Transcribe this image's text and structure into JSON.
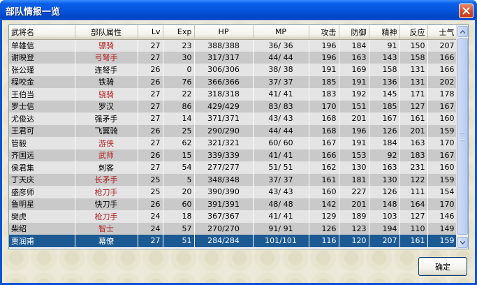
{
  "window": {
    "title": "部队情报一览",
    "ok_label": "确定"
  },
  "columns": [
    "武将名",
    "部队属性",
    "Lv",
    "Exp",
    "HP",
    "MP",
    "攻击",
    "防御",
    "精神",
    "反应",
    "士气"
  ],
  "rows": [
    {
      "name": "单雄信",
      "attr": "骠骑",
      "attr_red": true,
      "lv": "27",
      "exp": "23",
      "hp": "388/388",
      "mp": "36/ 36",
      "atk": "196",
      "def": "184",
      "spi": "91",
      "rea": "150",
      "mor": "207"
    },
    {
      "name": "谢映登",
      "attr": "弓弩手",
      "attr_red": true,
      "lv": "27",
      "exp": "30",
      "hp": "317/317",
      "mp": "44/ 44",
      "atk": "196",
      "def": "163",
      "spi": "143",
      "rea": "158",
      "mor": "166"
    },
    {
      "name": "张公瑾",
      "attr": "连弩手",
      "attr_red": false,
      "lv": "26",
      "exp": "0",
      "hp": "306/306",
      "mp": "38/ 38",
      "atk": "191",
      "def": "169",
      "spi": "158",
      "rea": "131",
      "mor": "166"
    },
    {
      "name": "程咬金",
      "attr": "铁骑",
      "attr_red": false,
      "lv": "26",
      "exp": "76",
      "hp": "366/366",
      "mp": "37/ 37",
      "atk": "185",
      "def": "191",
      "spi": "136",
      "rea": "131",
      "mor": "202"
    },
    {
      "name": "王伯当",
      "attr": "骁骑",
      "attr_red": true,
      "lv": "27",
      "exp": "22",
      "hp": "318/318",
      "mp": "41/ 41",
      "atk": "183",
      "def": "192",
      "spi": "145",
      "rea": "171",
      "mor": "178"
    },
    {
      "name": "罗士信",
      "attr": "罗汉",
      "attr_red": false,
      "lv": "27",
      "exp": "86",
      "hp": "429/429",
      "mp": "83/ 83",
      "atk": "170",
      "def": "151",
      "spi": "185",
      "rea": "127",
      "mor": "167"
    },
    {
      "name": "尤俊达",
      "attr": "强矛手",
      "attr_red": false,
      "lv": "27",
      "exp": "14",
      "hp": "371/371",
      "mp": "43/ 43",
      "atk": "168",
      "def": "201",
      "spi": "167",
      "rea": "161",
      "mor": "160"
    },
    {
      "name": "王君可",
      "attr": "飞翼骑",
      "attr_red": false,
      "lv": "26",
      "exp": "25",
      "hp": "290/290",
      "mp": "44/ 44",
      "atk": "168",
      "def": "196",
      "spi": "126",
      "rea": "201",
      "mor": "159"
    },
    {
      "name": "管毅",
      "attr": "游侠",
      "attr_red": true,
      "lv": "27",
      "exp": "62",
      "hp": "321/321",
      "mp": "60/ 60",
      "atk": "167",
      "def": "191",
      "spi": "184",
      "rea": "163",
      "mor": "170"
    },
    {
      "name": "齐国远",
      "attr": "武师",
      "attr_red": true,
      "lv": "26",
      "exp": "15",
      "hp": "339/339",
      "mp": "41/ 41",
      "atk": "166",
      "def": "153",
      "spi": "92",
      "rea": "183",
      "mor": "167"
    },
    {
      "name": "侯君集",
      "attr": "刺客",
      "attr_red": false,
      "lv": "27",
      "exp": "54",
      "hp": "277/277",
      "mp": "51/ 51",
      "atk": "162",
      "def": "130",
      "spi": "163",
      "rea": "231",
      "mor": "160"
    },
    {
      "name": "丁天庆",
      "attr": "长矛手",
      "attr_red": true,
      "lv": "25",
      "exp": "5",
      "hp": "348/348",
      "mp": "37/ 37",
      "atk": "161",
      "def": "181",
      "spi": "130",
      "rea": "122",
      "mor": "159"
    },
    {
      "name": "盛彦师",
      "attr": "枪刀手",
      "attr_red": true,
      "lv": "25",
      "exp": "20",
      "hp": "390/390",
      "mp": "43/ 43",
      "atk": "160",
      "def": "227",
      "spi": "126",
      "rea": "111",
      "mor": "154"
    },
    {
      "name": "鲁明星",
      "attr": "快刀手",
      "attr_red": false,
      "lv": "26",
      "exp": "60",
      "hp": "391/391",
      "mp": "48/ 48",
      "atk": "142",
      "def": "201",
      "spi": "148",
      "rea": "164",
      "mor": "170"
    },
    {
      "name": "樊虎",
      "attr": "枪刀手",
      "attr_red": true,
      "lv": "24",
      "exp": "18",
      "hp": "367/367",
      "mp": "41/ 41",
      "atk": "129",
      "def": "189",
      "spi": "103",
      "rea": "127",
      "mor": "146"
    },
    {
      "name": "柴绍",
      "attr": "智士",
      "attr_red": true,
      "lv": "24",
      "exp": "57",
      "hp": "270/270",
      "mp": "91/ 91",
      "atk": "126",
      "def": "123",
      "spi": "194",
      "rea": "110",
      "mor": "149"
    },
    {
      "name": "贾润甫",
      "attr": "幕僚",
      "attr_red": false,
      "lv": "27",
      "exp": "51",
      "hp": "284/284",
      "mp": "101/101",
      "atk": "116",
      "def": "120",
      "spi": "207",
      "rea": "161",
      "mor": "159",
      "selected": true
    }
  ],
  "icons": {
    "close": "close-icon",
    "scroll_up": "arrow-up-icon",
    "scroll_down": "arrow-down-icon"
  },
  "colors": {
    "title_bar": "#0653db",
    "selection": "#1c5a94",
    "row_light": "#e4e4e4",
    "row_dark": "#c9c9c9",
    "red_text": "#b02020"
  }
}
